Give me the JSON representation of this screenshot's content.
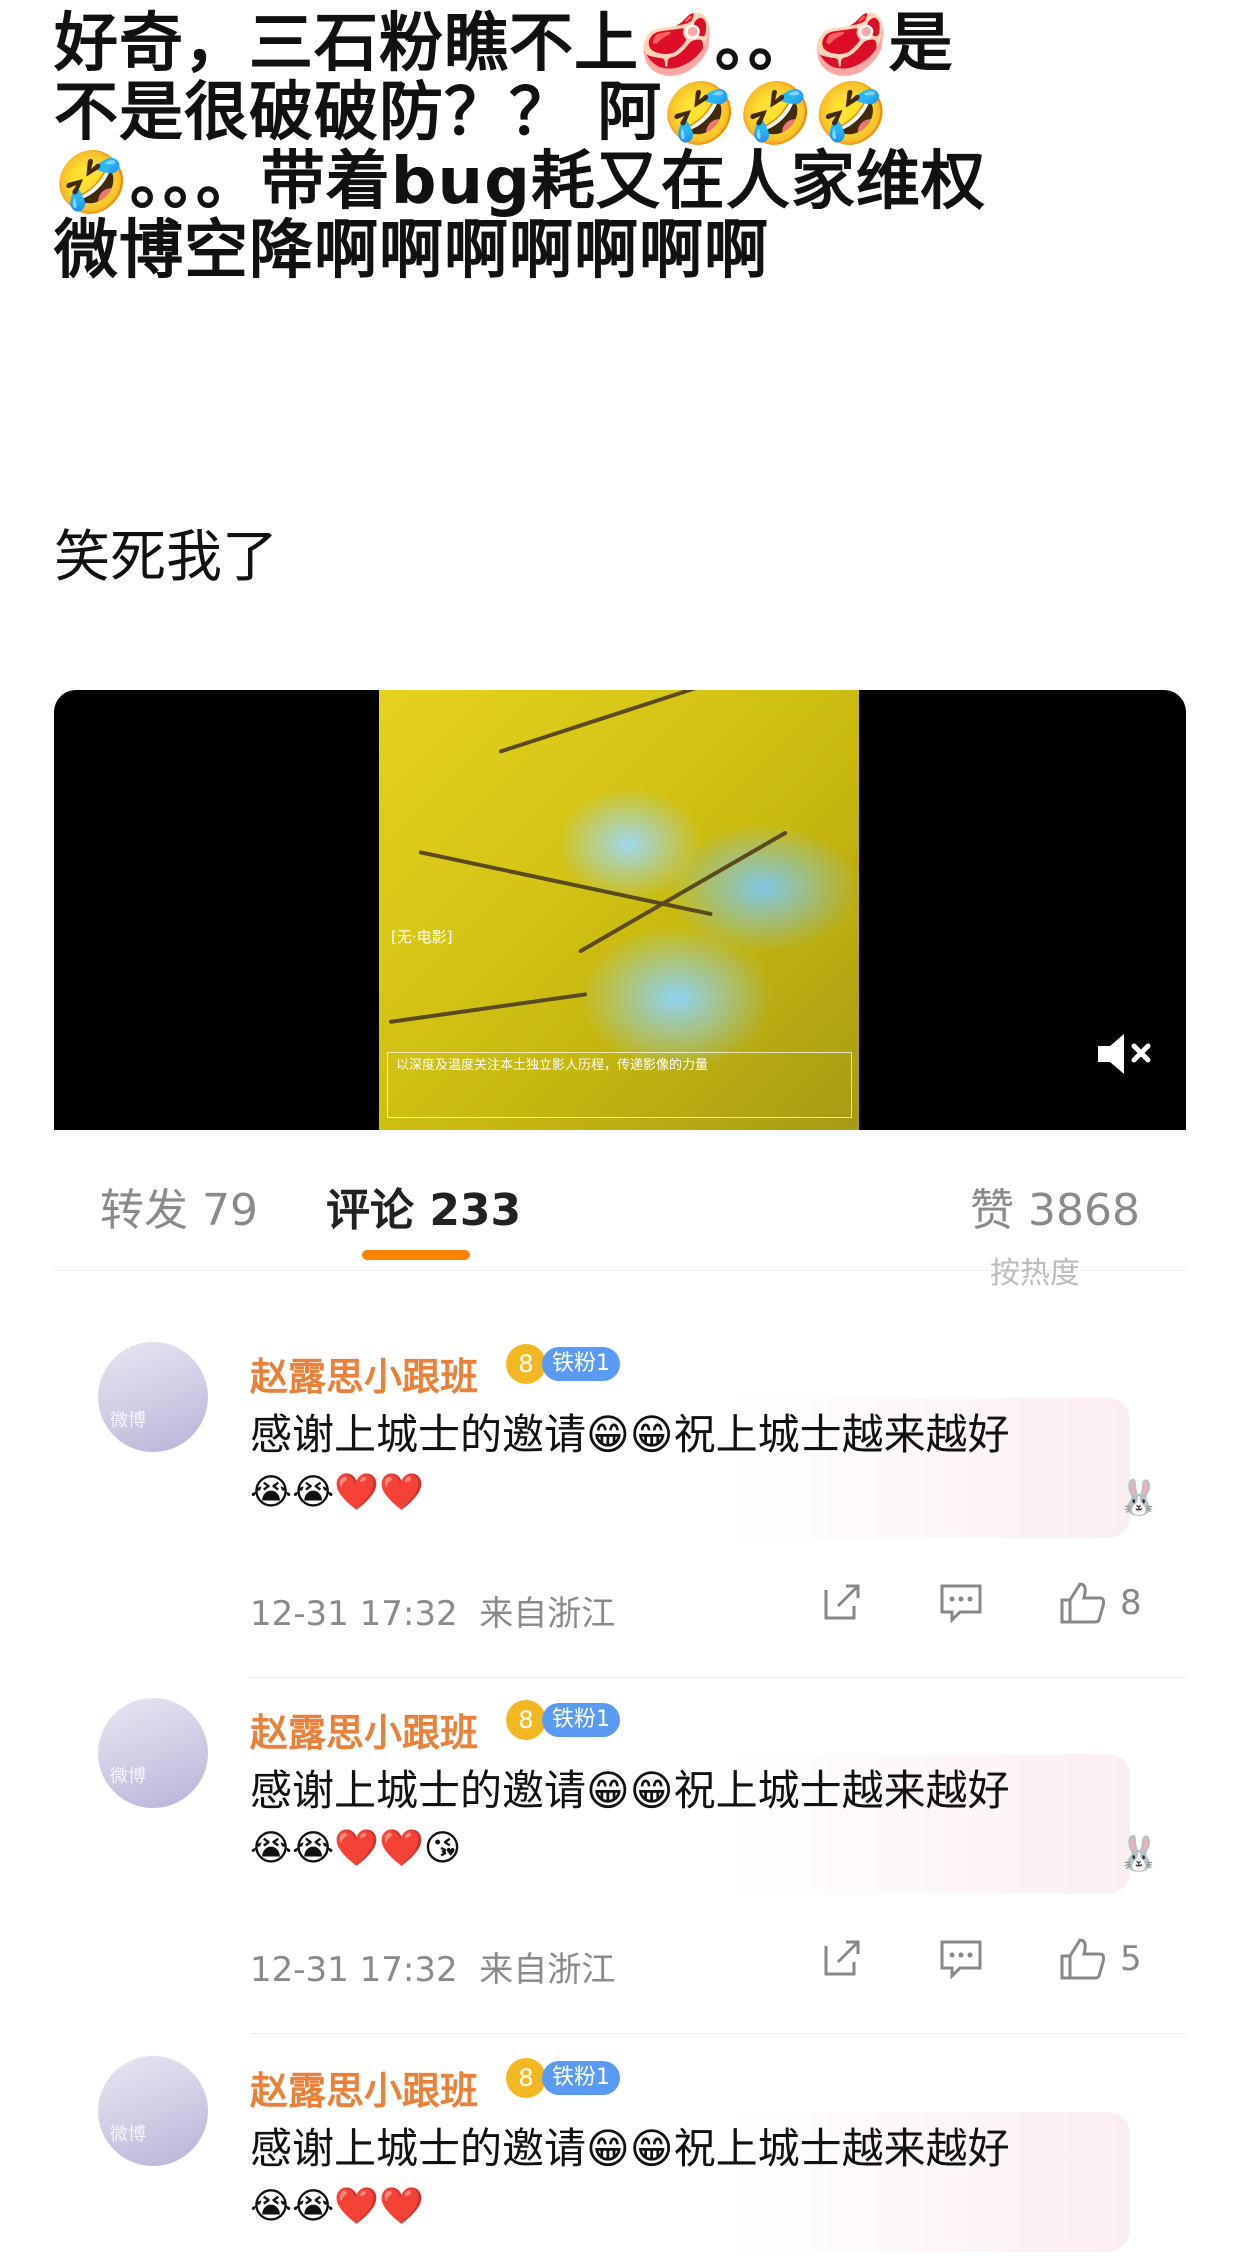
{
  "post": {
    "line1_a": "好奇，三石粉瞧不上",
    "line1_b": "。。",
    "line1_c": "是",
    "line2_a": "不是很破破防？？ 阿",
    "line3_b": "。。。带着bug耗又在人家维权",
    "line4": "微博空降啊啊啊啊啊啊啊",
    "subtext": "笑死我了",
    "emoji_meat": "🥩",
    "emoji_laugh": "🤣"
  },
  "video": {
    "tag_text": "[无·电影]",
    "caption_text": "以深度及温度关注本土独立影人历程，传递影像的力量",
    "mute_icon": "muted-speaker-icon"
  },
  "tabs": {
    "repost": "转发 79",
    "comment": "评论 233",
    "like": "赞 3868",
    "accent_color": "#ff8200"
  },
  "sort_hint": "按热度",
  "comments": [
    {
      "avatar_text": "微博",
      "name": "赵露思小跟班",
      "crown": "8",
      "fan_badge": "铁粉1",
      "text": "感谢上城士的邀请😁😁祝上城士越来越好",
      "emojis": "😭😭❤️❤️",
      "time": "12-31 17:32",
      "location": "来自浙江",
      "likes": "8"
    },
    {
      "avatar_text": "微博",
      "name": "赵露思小跟班",
      "crown": "8",
      "fan_badge": "铁粉1",
      "text": "感谢上城士的邀请😁😁祝上城士越来越好",
      "emojis": "😭😭❤️❤️😘",
      "time": "12-31 17:32",
      "location": "来自浙江",
      "likes": "5"
    },
    {
      "avatar_text": "微博",
      "name": "赵露思小跟班",
      "crown": "8",
      "fan_badge": "铁粉1",
      "text": "感谢上城士的邀请😁😁祝上城士越来越好",
      "emojis": "😭😭❤️❤️",
      "time": "",
      "location": "",
      "likes": ""
    }
  ]
}
